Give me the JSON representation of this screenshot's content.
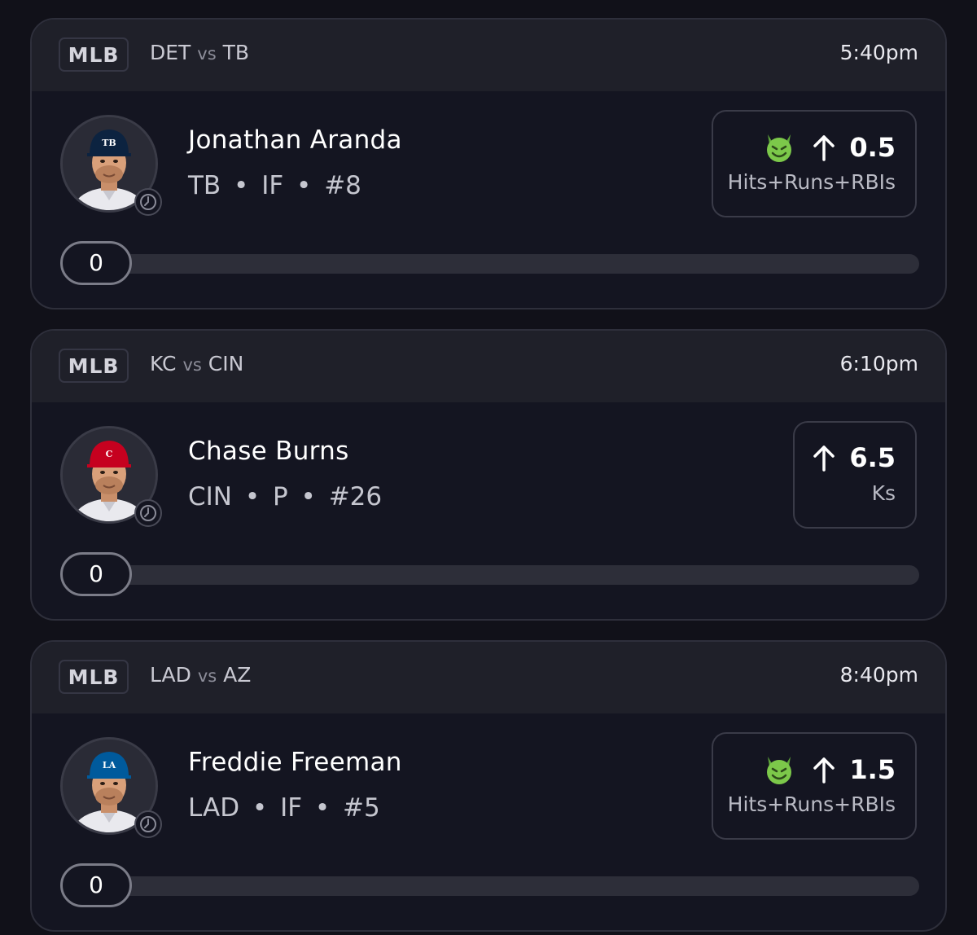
{
  "colors": {
    "background": "#111119",
    "card": "#141521",
    "header": "#1f2029",
    "border": "#2e2f3b",
    "demon_green": "#7cc84a",
    "progress_track": "#2d2e39"
  },
  "cards": [
    {
      "league": "MLB",
      "team_a": "DET",
      "vs": "vs",
      "team_b": "TB",
      "time": "5:40pm",
      "player": {
        "name": "Jonathan Aranda",
        "team": "TB",
        "position": "IF",
        "number": "#8",
        "cap_color": "#0c2340",
        "cap_logo": "TB"
      },
      "prop": {
        "demon": true,
        "direction_icon": "arrow-up-icon",
        "line": "0.5",
        "stat": "Hits+Runs+RBIs"
      },
      "progress": {
        "value": "0",
        "fraction": 0
      }
    },
    {
      "league": "MLB",
      "team_a": "KC",
      "vs": "vs",
      "team_b": "CIN",
      "time": "6:10pm",
      "player": {
        "name": "Chase Burns",
        "team": "CIN",
        "position": "P",
        "number": "#26",
        "cap_color": "#c6011f",
        "cap_logo": "C"
      },
      "prop": {
        "demon": false,
        "direction_icon": "arrow-up-icon",
        "line": "6.5",
        "stat": "Ks"
      },
      "progress": {
        "value": "0",
        "fraction": 0
      }
    },
    {
      "league": "MLB",
      "team_a": "LAD",
      "vs": "vs",
      "team_b": "AZ",
      "time": "8:40pm",
      "player": {
        "name": "Freddie Freeman",
        "team": "LAD",
        "position": "IF",
        "number": "#5",
        "cap_color": "#005a9c",
        "cap_logo": "LA"
      },
      "prop": {
        "demon": true,
        "direction_icon": "arrow-up-icon",
        "line": "1.5",
        "stat": "Hits+Runs+RBIs"
      },
      "progress": {
        "value": "0",
        "fraction": 0
      }
    }
  ]
}
